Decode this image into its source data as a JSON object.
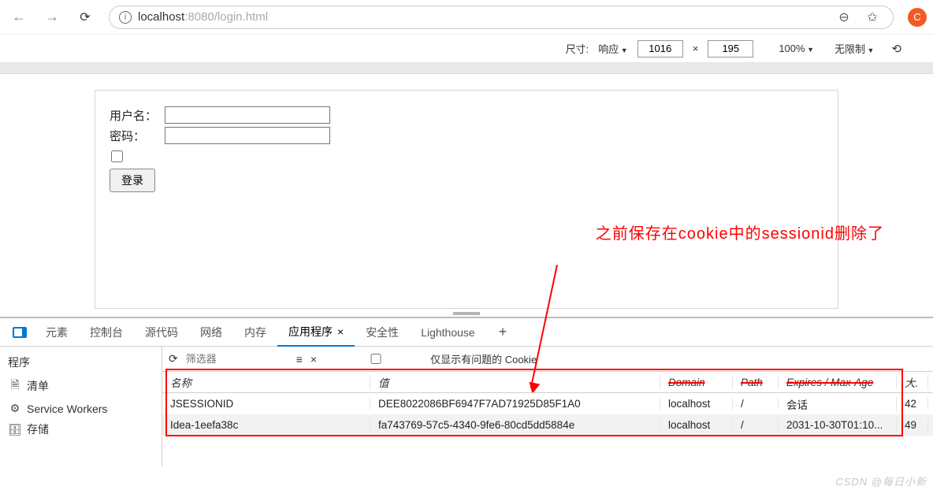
{
  "address": {
    "host": "localhost",
    "port": ":8080",
    "path": "/login.html"
  },
  "responsive": {
    "size_label": "尺寸:",
    "mode": "响应",
    "width": "1016",
    "x": "×",
    "height": "195",
    "zoom": "100%",
    "throttle": "无限制",
    "rotate_icon": "rotate"
  },
  "form": {
    "user_label": "用户名：",
    "pass_label": "密码：",
    "login_label": "登录"
  },
  "annotation": "之前保存在cookie中的sessionid删除了",
  "devtools": {
    "tabs": {
      "elements": "元素",
      "console": "控制台",
      "sources": "源代码",
      "network": "网络",
      "memory": "内存",
      "application": "应用程序",
      "security": "安全性",
      "lighthouse": "Lighthouse"
    },
    "sidebar": {
      "header": "程序",
      "manifest": "清单",
      "sw": "Service Workers",
      "storage": "存储"
    },
    "filter": {
      "placeholder": "筛选器",
      "only_issues": "仅显示有问题的 Cookie"
    },
    "columns": {
      "name": "名称",
      "value": "值",
      "domain": "Domain",
      "path": "Path",
      "expires": "Expires / Max-Age",
      "size": "大."
    },
    "rows": [
      {
        "name": "JSESSIONID",
        "value": "DEE8022086BF6947F7AD71925D85F1A0",
        "domain": "localhost",
        "path": "/",
        "expires": "会话",
        "size": "42"
      },
      {
        "name": "Idea-1eefa38c",
        "value": "fa743769-57c5-4340-9fe6-80cd5dd5884e",
        "domain": "localhost",
        "path": "/",
        "expires": "2031-10-30T01:10...",
        "size": "49"
      }
    ]
  },
  "watermark": "CSDN @每日小新"
}
